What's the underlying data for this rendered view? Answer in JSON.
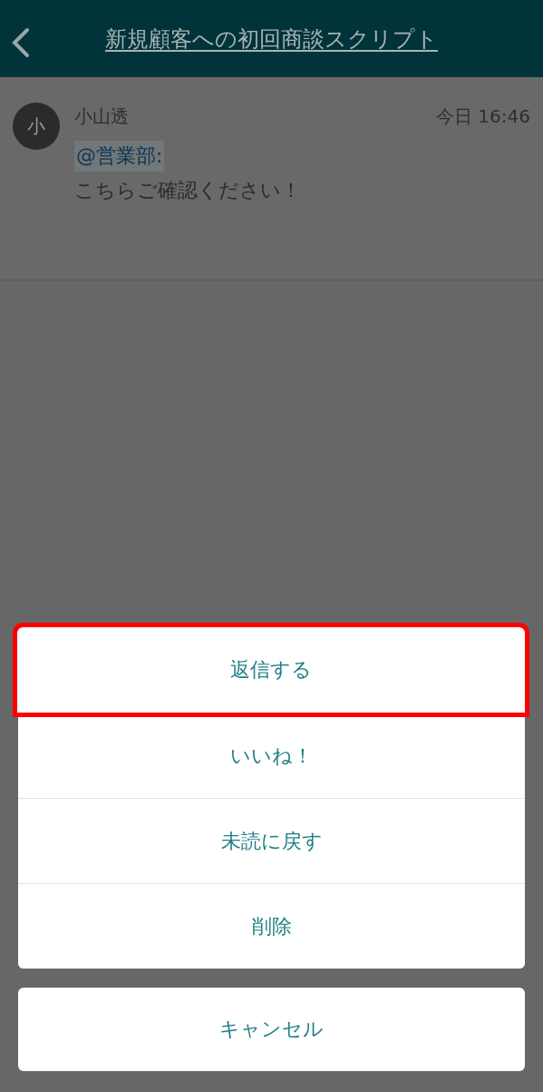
{
  "header": {
    "title": "新規顧客への初回商談スクリプト"
  },
  "message": {
    "avatar_initial": "小",
    "author": "小山透",
    "time": "今日 16:46",
    "mention": "@営業部:",
    "text": "こちらご確認ください！"
  },
  "action_sheet": {
    "actions": [
      {
        "label": "返信する",
        "highlighted": true
      },
      {
        "label": "いいね！",
        "highlighted": false
      },
      {
        "label": "未読に戻す",
        "highlighted": false
      },
      {
        "label": "削除",
        "highlighted": false
      }
    ],
    "cancel": "キャンセル"
  }
}
